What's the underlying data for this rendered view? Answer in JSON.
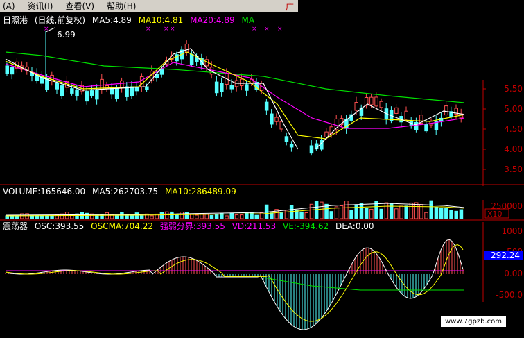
{
  "menu": {
    "items": [
      "(A)",
      "资讯(I)",
      "查看(V)",
      "帮助(H)"
    ],
    "extra": "广"
  },
  "price_panel": {
    "stock_name": "日照港",
    "period": "(日线,前复权)",
    "ma5": "MA5:4.89",
    "ma10": "MA10:4.81",
    "ma20": "MA20:4.89",
    "ma_extra": "MA",
    "high_label": "6.99",
    "axis_ticks": [
      "5.50",
      "5.00",
      "4.50",
      "4.00",
      "3.50"
    ]
  },
  "volume_panel": {
    "volume": "VOLUME:165646.00",
    "ma5": "MA5:262703.75",
    "ma10": "MA10:286489.09",
    "axis_tick": "250000",
    "unit": "X10"
  },
  "osc_panel": {
    "name": "震荡器",
    "osc": "OSC:393.55",
    "oscma": "OSCMA:704.22",
    "boundary": "强弱分界:393.55",
    "vd": "VD:211.53",
    "ve": "VE:-394.62",
    "dea": "DEA:0.00",
    "axis_ticks": [
      "1000",
      "500",
      "0.00",
      "-500.0"
    ],
    "current_value": "292.24"
  },
  "watermark": "www.7gpzb.com",
  "colors": {
    "up": "#ff5050",
    "down": "#54ffff",
    "ma5": "#ffffff",
    "ma10": "#ffff00",
    "ma20": "#ff00ff",
    "ma60": "#00e000",
    "axis": "#c00000",
    "highlight": "#0000ff"
  }
}
